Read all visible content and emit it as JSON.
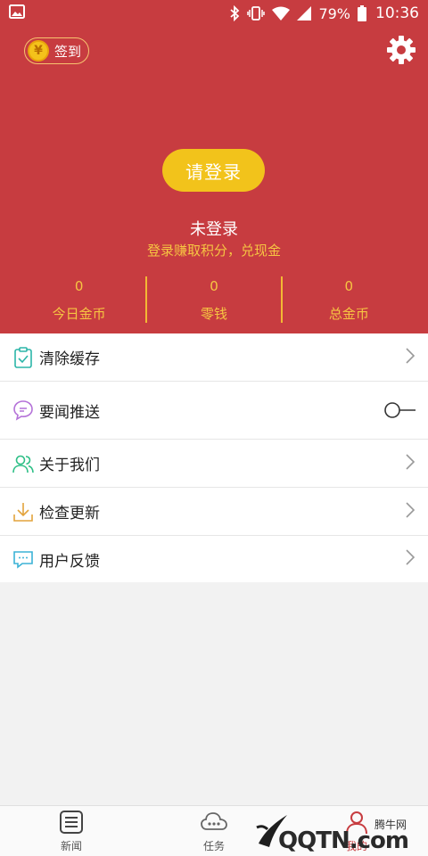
{
  "status_bar": {
    "battery_percent": "79%",
    "time": "10:36"
  },
  "header": {
    "checkin_label": "签到",
    "coin_symbol": "¥",
    "login_button": "请登录",
    "username": "未登录",
    "tagline": "登录赚取积分，兑现金",
    "stats": [
      {
        "value": "0",
        "label": "今日金币"
      },
      {
        "value": "0",
        "label": "零钱"
      },
      {
        "value": "0",
        "label": "总金币"
      }
    ]
  },
  "menu": {
    "items": [
      {
        "label": "清除缓存",
        "icon": "clipboard-check-icon",
        "accessory": "chevron"
      },
      {
        "label": "要闻推送",
        "icon": "chat-bubble-icon",
        "accessory": "toggle",
        "toggle_on": false
      },
      {
        "label": "关于我们",
        "icon": "users-icon",
        "accessory": "chevron"
      },
      {
        "label": "检查更新",
        "icon": "download-icon",
        "accessory": "chevron"
      },
      {
        "label": "用户反馈",
        "icon": "message-icon",
        "accessory": "chevron"
      }
    ]
  },
  "tabbar": {
    "tabs": [
      {
        "label": "新闻",
        "icon": "news-icon"
      },
      {
        "label": "任务",
        "icon": "cloud-icon"
      },
      {
        "label": "我的",
        "icon": "profile-icon"
      }
    ],
    "active": "我的"
  },
  "watermark": {
    "site": "腾牛网",
    "brand": "QQTN.com"
  },
  "colors": {
    "header_bg": "#c73c40",
    "accent_yellow": "#f2c31b",
    "stat_text": "#f6c542"
  }
}
